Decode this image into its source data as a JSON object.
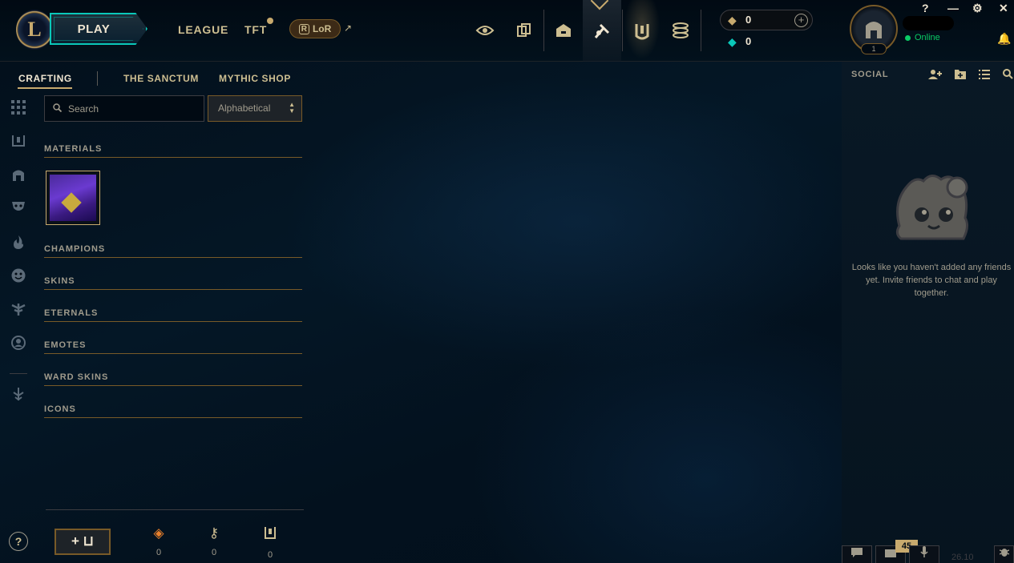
{
  "topnav": {
    "play_label": "PLAY",
    "league_label": "LEAGUE",
    "tft_label": "TFT",
    "lor_label": "LoR",
    "lor_badge": "R",
    "lor_external": "↗"
  },
  "currency": {
    "rp_value": "0",
    "be_value": "0",
    "add_label": "+"
  },
  "profile": {
    "level": "1",
    "status": "Online"
  },
  "window_controls": {
    "help": "?",
    "minimize": "—",
    "settings": "⚙",
    "close": "✕"
  },
  "crafting": {
    "tabs": [
      {
        "label": "CRAFTING",
        "active": true
      },
      {
        "label": "THE SANCTUM",
        "active": false
      },
      {
        "label": "MYTHIC SHOP",
        "active": false
      }
    ],
    "search_placeholder": "Search",
    "sort_value": "Alphabetical",
    "sections": [
      "MATERIALS",
      "CHAMPIONS",
      "SKINS",
      "ETERNALS",
      "EMOTES",
      "WARD SKINS",
      "ICONS"
    ]
  },
  "loot_bar": {
    "help": "?",
    "add_chest_label": "+ ⊔",
    "orange_essence": "0",
    "keys": "0",
    "chests": "0"
  },
  "social": {
    "title": "SOCIAL",
    "empty_message": "Looks like you haven't added any friends yet. Invite friends to chat and play together.",
    "badge": "45",
    "version": "26.10"
  },
  "colors": {
    "gold": "#c8aa6e",
    "teal": "#0ac8b9",
    "online": "#0acb65",
    "background": "#010a13"
  }
}
